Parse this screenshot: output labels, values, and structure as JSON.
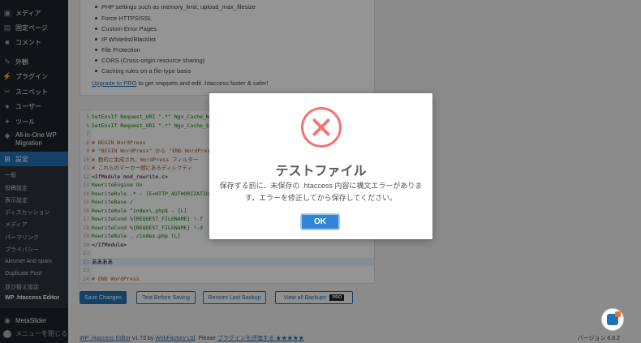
{
  "sidebar": {
    "items": [
      {
        "label": "メディア",
        "icon": "media-icon"
      },
      {
        "label": "固定ページ",
        "icon": "page-icon"
      },
      {
        "label": "コメント",
        "icon": "comment-icon"
      },
      {
        "label": "外観",
        "icon": "appearance-icon"
      },
      {
        "label": "プラグイン",
        "icon": "plugin-icon"
      },
      {
        "label": "スニペット",
        "icon": "snippets-icon"
      },
      {
        "label": "ユーザー",
        "icon": "user-icon"
      },
      {
        "label": "ツール",
        "icon": "tools-icon"
      },
      {
        "label": "All-in-One WP Migration",
        "icon": "migration-icon"
      },
      {
        "label": "設定",
        "icon": "settings-icon"
      }
    ],
    "submenu": [
      "一般",
      "投稿設定",
      "表示設定",
      "ディスカッション",
      "メディア",
      "パーマリンク",
      "プライバシー",
      "Akismet Anti-spam",
      "Duplicate Post",
      "並び替え設定",
      "WP .htaccess Editor"
    ],
    "metaslider": "MetaSlider",
    "collapse": "メニューを閉じる"
  },
  "features": {
    "items": [
      "PHP settings such as memory_limit, upload_max_filesize",
      "Force HTTPS/SSL",
      "Custom Error Pages",
      "IP Whitelist/Blacklist",
      "File Protection",
      "CORS (Cross-origin resource sharing)",
      "Caching rules on a file-type basis"
    ],
    "upgrade_link": "Upgrade to PRO",
    "upgrade_rest": " to get snippets and edit .htaccess faster & safer!"
  },
  "editor": {
    "lines": [
      {
        "n": "5",
        "text": "SetEnvIf Request_URI \".*\" Ngx_Cache_No",
        "cls": "c-green"
      },
      {
        "n": "6",
        "text": "SetEnvIf Request_URI \".*\" Ngx_Cache_S",
        "cls": "c-green"
      },
      {
        "n": "7",
        "text": "",
        "cls": ""
      },
      {
        "n": "8",
        "text": "# BEGIN WordPress",
        "cls": "c-comment"
      },
      {
        "n": "9",
        "text": "# \"BEGIN WordPress\" から \"END WordPres",
        "cls": "c-comment"
      },
      {
        "n": "10",
        "text": "# 動的に生成され、WordPress フィルター",
        "cls": "c-comment"
      },
      {
        "n": "11",
        "text": "# これらのマーカー間にあるディレクティ",
        "cls": "c-comment"
      },
      {
        "n": "12",
        "text": "<IfModule mod_rewrite.c>",
        "cls": "c-dir"
      },
      {
        "n": "13",
        "text": "RewriteEngine On",
        "cls": "c-green"
      },
      {
        "n": "14",
        "text": "RewriteRule .* - [E=HTTP_AUTHORIZATION",
        "cls": "c-green"
      },
      {
        "n": "15",
        "text": "RewriteBase /",
        "cls": "c-green"
      },
      {
        "n": "16",
        "text": "RewriteRule ^index\\.php$ - [L]",
        "cls": "c-green"
      },
      {
        "n": "17",
        "text": "RewriteCond %{REQUEST_FILENAME} !-f",
        "cls": "c-green"
      },
      {
        "n": "18",
        "text": "RewriteCond %{REQUEST_FILENAME} !-d",
        "cls": "c-green"
      },
      {
        "n": "19",
        "text": "RewriteRule . /index.php [L]",
        "cls": "c-green"
      },
      {
        "n": "20",
        "text": "</IfModule>",
        "cls": "c-dir"
      },
      {
        "n": "21",
        "text": "",
        "cls": ""
      },
      {
        "n": "22",
        "text": "ああああ",
        "cls": "c-dir"
      },
      {
        "n": "23",
        "text": "",
        "cls": ""
      },
      {
        "n": "24",
        "text": "# END WordPress",
        "cls": "c-comment"
      }
    ]
  },
  "buttons": {
    "save": "Save Changes",
    "test": "Test Before Saving",
    "restore": "Restore Last Backup",
    "backups": "View all Backups",
    "pro_badge": "PRO"
  },
  "footer": {
    "plugin_link": "WP .htaccess Editor",
    "version_by": " v1.73 by ",
    "author_link": "WebFactory Ltd",
    "please": ". Please ",
    "rate_link": "プラグインを評価する ★★★★★",
    "wp_version": "バージョン 6.8.2"
  },
  "modal": {
    "title": "テストファイル",
    "message": "保存する前に、未保存の .htaccess 内容に構文エラーがあります。エラーを修正してから保存してください。",
    "ok": "OK"
  }
}
